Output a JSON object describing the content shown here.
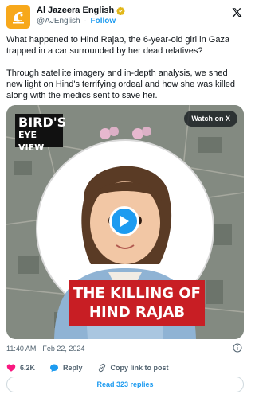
{
  "author": {
    "name": "Al Jazeera English",
    "handle": "@AJEnglish",
    "separator": "·",
    "follow_label": "Follow",
    "avatar_text": "الجزيرة"
  },
  "tweet": {
    "paragraph1": "What happened to Hind Rajab, the 6-year-old girl in Gaza trapped in a car surrounded by her dead relatives?",
    "paragraph2": "Through satellite imagery and in-depth analysis, we shed new light on Hind's terrifying ordeal and how she was killed along with the medics sent to save her."
  },
  "media": {
    "badge_line1": "BIRD'S",
    "badge_line2": "EYE VIEW",
    "watch_label": "Watch on X",
    "banner_line1": "THE KILLING OF",
    "banner_line2": "HIND RAJAB"
  },
  "meta": {
    "timestamp": "11:40 AM · Feb 22, 2024"
  },
  "actions": {
    "likes": "6.2K",
    "reply_label": "Reply",
    "copy_label": "Copy link to post"
  },
  "read_replies_label": "Read 323 replies",
  "colors": {
    "accent": "#1d9bf0",
    "like": "#f91880",
    "avatar": "#f7a81b",
    "banner": "#c81e24"
  }
}
